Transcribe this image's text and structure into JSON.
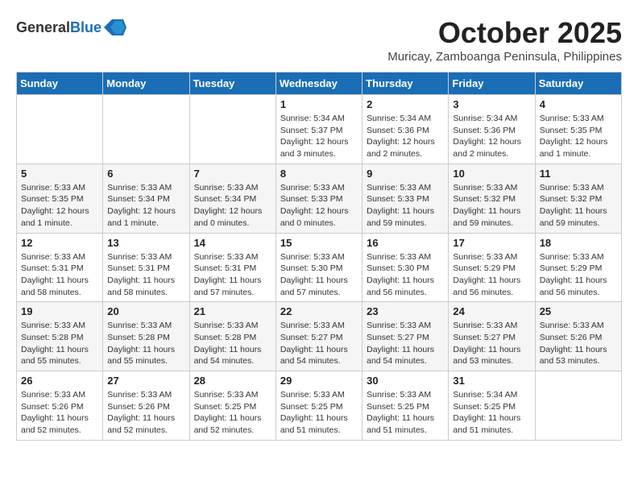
{
  "header": {
    "logo_general": "General",
    "logo_blue": "Blue",
    "month": "October 2025",
    "location": "Muricay, Zamboanga Peninsula, Philippines"
  },
  "days_of_week": [
    "Sunday",
    "Monday",
    "Tuesday",
    "Wednesday",
    "Thursday",
    "Friday",
    "Saturday"
  ],
  "weeks": [
    [
      {
        "day": "",
        "content": ""
      },
      {
        "day": "",
        "content": ""
      },
      {
        "day": "",
        "content": ""
      },
      {
        "day": "1",
        "content": "Sunrise: 5:34 AM\nSunset: 5:37 PM\nDaylight: 12 hours\nand 3 minutes."
      },
      {
        "day": "2",
        "content": "Sunrise: 5:34 AM\nSunset: 5:36 PM\nDaylight: 12 hours\nand 2 minutes."
      },
      {
        "day": "3",
        "content": "Sunrise: 5:34 AM\nSunset: 5:36 PM\nDaylight: 12 hours\nand 2 minutes."
      },
      {
        "day": "4",
        "content": "Sunrise: 5:33 AM\nSunset: 5:35 PM\nDaylight: 12 hours\nand 1 minute."
      }
    ],
    [
      {
        "day": "5",
        "content": "Sunrise: 5:33 AM\nSunset: 5:35 PM\nDaylight: 12 hours\nand 1 minute."
      },
      {
        "day": "6",
        "content": "Sunrise: 5:33 AM\nSunset: 5:34 PM\nDaylight: 12 hours\nand 1 minute."
      },
      {
        "day": "7",
        "content": "Sunrise: 5:33 AM\nSunset: 5:34 PM\nDaylight: 12 hours\nand 0 minutes."
      },
      {
        "day": "8",
        "content": "Sunrise: 5:33 AM\nSunset: 5:33 PM\nDaylight: 12 hours\nand 0 minutes."
      },
      {
        "day": "9",
        "content": "Sunrise: 5:33 AM\nSunset: 5:33 PM\nDaylight: 11 hours\nand 59 minutes."
      },
      {
        "day": "10",
        "content": "Sunrise: 5:33 AM\nSunset: 5:32 PM\nDaylight: 11 hours\nand 59 minutes."
      },
      {
        "day": "11",
        "content": "Sunrise: 5:33 AM\nSunset: 5:32 PM\nDaylight: 11 hours\nand 59 minutes."
      }
    ],
    [
      {
        "day": "12",
        "content": "Sunrise: 5:33 AM\nSunset: 5:31 PM\nDaylight: 11 hours\nand 58 minutes."
      },
      {
        "day": "13",
        "content": "Sunrise: 5:33 AM\nSunset: 5:31 PM\nDaylight: 11 hours\nand 58 minutes."
      },
      {
        "day": "14",
        "content": "Sunrise: 5:33 AM\nSunset: 5:31 PM\nDaylight: 11 hours\nand 57 minutes."
      },
      {
        "day": "15",
        "content": "Sunrise: 5:33 AM\nSunset: 5:30 PM\nDaylight: 11 hours\nand 57 minutes."
      },
      {
        "day": "16",
        "content": "Sunrise: 5:33 AM\nSunset: 5:30 PM\nDaylight: 11 hours\nand 56 minutes."
      },
      {
        "day": "17",
        "content": "Sunrise: 5:33 AM\nSunset: 5:29 PM\nDaylight: 11 hours\nand 56 minutes."
      },
      {
        "day": "18",
        "content": "Sunrise: 5:33 AM\nSunset: 5:29 PM\nDaylight: 11 hours\nand 56 minutes."
      }
    ],
    [
      {
        "day": "19",
        "content": "Sunrise: 5:33 AM\nSunset: 5:28 PM\nDaylight: 11 hours\nand 55 minutes."
      },
      {
        "day": "20",
        "content": "Sunrise: 5:33 AM\nSunset: 5:28 PM\nDaylight: 11 hours\nand 55 minutes."
      },
      {
        "day": "21",
        "content": "Sunrise: 5:33 AM\nSunset: 5:28 PM\nDaylight: 11 hours\nand 54 minutes."
      },
      {
        "day": "22",
        "content": "Sunrise: 5:33 AM\nSunset: 5:27 PM\nDaylight: 11 hours\nand 54 minutes."
      },
      {
        "day": "23",
        "content": "Sunrise: 5:33 AM\nSunset: 5:27 PM\nDaylight: 11 hours\nand 54 minutes."
      },
      {
        "day": "24",
        "content": "Sunrise: 5:33 AM\nSunset: 5:27 PM\nDaylight: 11 hours\nand 53 minutes."
      },
      {
        "day": "25",
        "content": "Sunrise: 5:33 AM\nSunset: 5:26 PM\nDaylight: 11 hours\nand 53 minutes."
      }
    ],
    [
      {
        "day": "26",
        "content": "Sunrise: 5:33 AM\nSunset: 5:26 PM\nDaylight: 11 hours\nand 52 minutes."
      },
      {
        "day": "27",
        "content": "Sunrise: 5:33 AM\nSunset: 5:26 PM\nDaylight: 11 hours\nand 52 minutes."
      },
      {
        "day": "28",
        "content": "Sunrise: 5:33 AM\nSunset: 5:25 PM\nDaylight: 11 hours\nand 52 minutes."
      },
      {
        "day": "29",
        "content": "Sunrise: 5:33 AM\nSunset: 5:25 PM\nDaylight: 11 hours\nand 51 minutes."
      },
      {
        "day": "30",
        "content": "Sunrise: 5:33 AM\nSunset: 5:25 PM\nDaylight: 11 hours\nand 51 minutes."
      },
      {
        "day": "31",
        "content": "Sunrise: 5:34 AM\nSunset: 5:25 PM\nDaylight: 11 hours\nand 51 minutes."
      },
      {
        "day": "",
        "content": ""
      }
    ]
  ]
}
